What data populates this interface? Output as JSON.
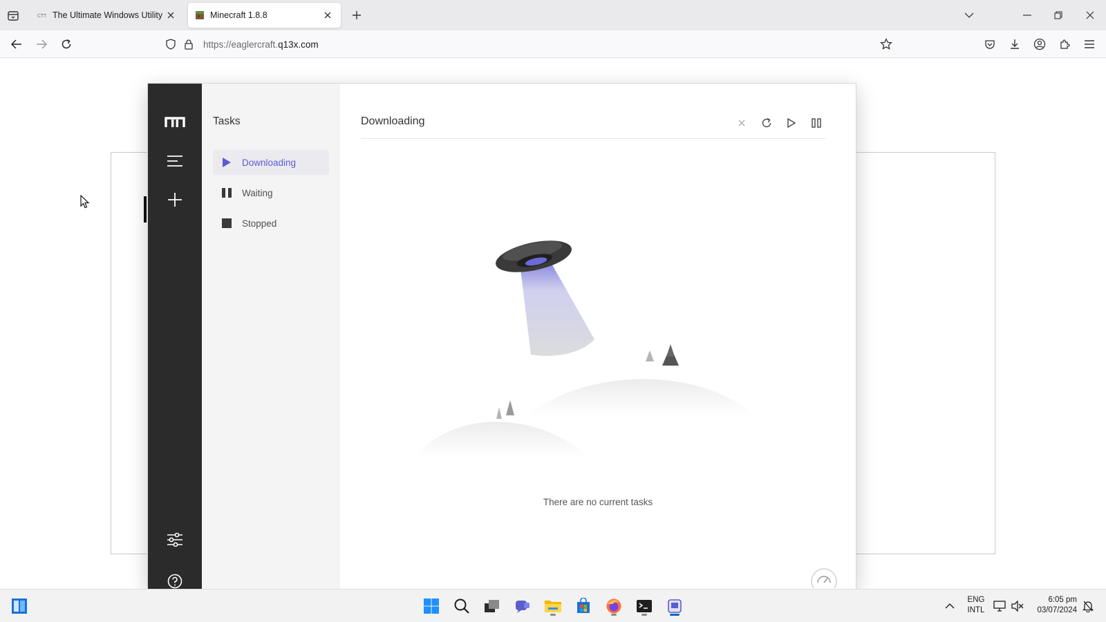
{
  "browser": {
    "tabs": [
      {
        "title": "The Ultimate Windows Utility",
        "active": false,
        "favicon": "ctt-favicon"
      },
      {
        "title": "Minecraft 1.8.8",
        "active": true,
        "favicon": "minecraft-block-favicon"
      }
    ],
    "url": {
      "prefix": "https://eaglercraft.",
      "domain": "q13x.com"
    }
  },
  "app": {
    "sidebar_title": "Tasks",
    "task_categories": [
      {
        "label": "Downloading",
        "icon": "play-icon",
        "active": true
      },
      {
        "label": "Waiting",
        "icon": "pause-icon",
        "active": false
      },
      {
        "label": "Stopped",
        "icon": "stop-icon",
        "active": false
      }
    ],
    "main_title": "Downloading",
    "empty_message": "There are no current tasks",
    "accent_color": "#5b5bd6"
  },
  "taskbar": {
    "apps": [
      "windows-start",
      "search",
      "task-view",
      "teams",
      "file-explorer",
      "microsoft-store",
      "firefox",
      "terminal",
      "motrix"
    ],
    "language": {
      "line1": "ENG",
      "line2": "INTL"
    },
    "clock": {
      "time": "6:05 pm",
      "date": "03/07/2024"
    }
  }
}
